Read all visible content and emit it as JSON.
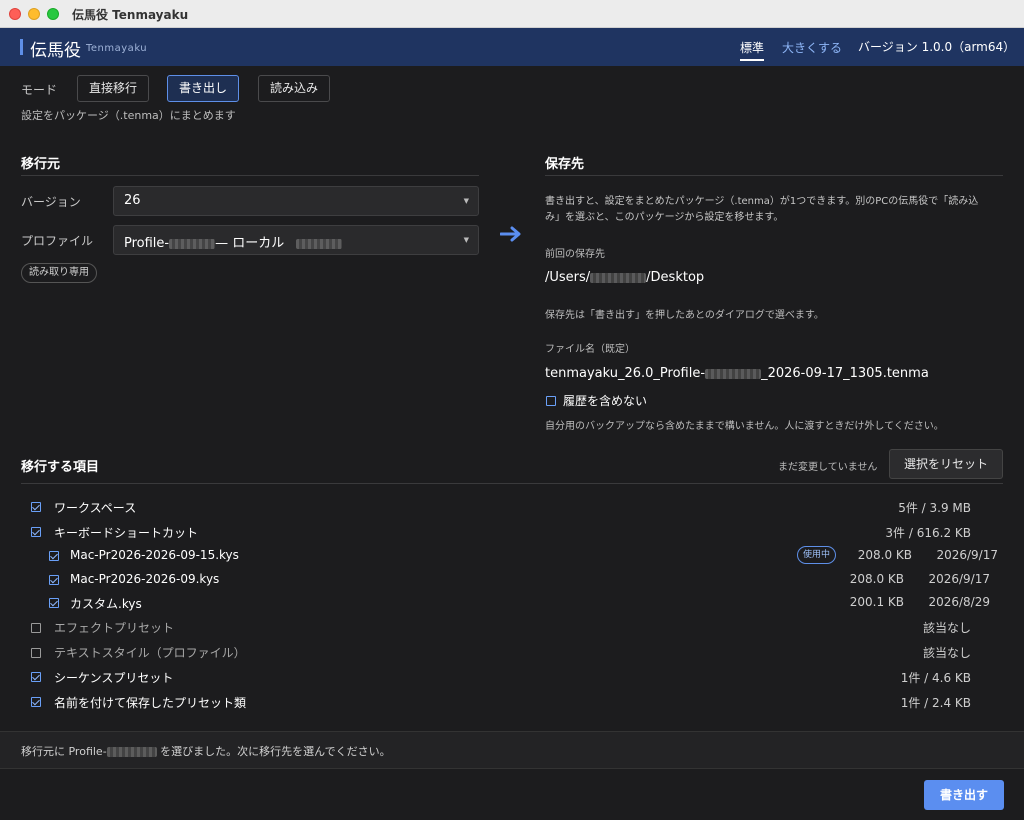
{
  "window": {
    "title": "伝馬役 Tenmayaku"
  },
  "header": {
    "app_name": "伝馬役",
    "app_sub": "Tenmayaku",
    "size_standard": "標準",
    "size_large": "大きくする",
    "version": "バージョン 1.0.0（arm64）"
  },
  "mode": {
    "label": "モード",
    "options": [
      "直接移行",
      "書き出し",
      "読み込み"
    ],
    "selected": "書き出し",
    "description": "設定をパッケージ（.tenma）にまとめます"
  },
  "source": {
    "title": "移行元",
    "version_label": "バージョン",
    "version_value": "26",
    "profile_label": "プロファイル",
    "profile_prefix": "Profile-",
    "profile_middle": "— ローカル",
    "readonly_pill": "読み取り専用"
  },
  "destination": {
    "title": "保存先",
    "note": "書き出すと、設定をまとめたパッケージ（.tenma）が1つできます。別のPCの伝馬役で「読み込み」を選ぶと、このパッケージから設定を移せます。",
    "note_line1": "書き出すと、設定をまとめたパッケージ（.tenma）が1つできます。別のPCの伝馬役で「読み込",
    "note_line2": "み」を選ぶと、このパッケージから設定を移せます。",
    "last_label": "前回の保存先",
    "last_prefix": "/Users/",
    "last_suffix": "/Desktop",
    "dialog_note": "保存先は「書き出す」を押したあとのダイアログで選べます。",
    "filename_label": "ファイル名（既定）",
    "filename_prefix": "tenmayaku_26.0_Profile-",
    "filename_suffix": "_2026-09-17_1305.tenma",
    "exclude_history_label": "履歴を含めない",
    "exclude_history_checked": false,
    "exclude_history_note": "自分用のバックアップなら含めたままで構いません。人に渡すときだけ外してください。"
  },
  "items": {
    "title": "移行する項目",
    "unchanged": "まだ変更していません",
    "reset_label": "選択をリセット",
    "rows": [
      {
        "label": "ワークスペース",
        "checked": true,
        "info": "5件 / 3.9 MB"
      },
      {
        "label": "キーボードショートカット",
        "checked": true,
        "info": "3件 / 616.2 KB"
      },
      {
        "label": "Mac-Pr2026-2026-09-15.kys",
        "checked": true,
        "badge": "使用中",
        "size": "208.0 KB",
        "date": "2026/9/17"
      },
      {
        "label": "Mac-Pr2026-2026-09.kys",
        "checked": true,
        "size": "208.0 KB",
        "date": "2026/9/17"
      },
      {
        "label": "カスタム.kys",
        "checked": true,
        "size": "200.1 KB",
        "date": "2026/8/29"
      },
      {
        "label": "エフェクトプリセット",
        "checked": false,
        "info": "該当なし"
      },
      {
        "label": "テキストスタイル（プロファイル）",
        "checked": false,
        "info": "該当なし"
      },
      {
        "label": "シーケンスプリセット",
        "checked": true,
        "info": "1件 / 4.6 KB"
      },
      {
        "label": "名前を付けて保存したプリセット類",
        "checked": true,
        "info": "1件 / 2.4 KB"
      }
    ]
  },
  "status": {
    "prefix": "移行元に Profile-",
    "suffix": " を選びました。次に移行先を選んでください。"
  },
  "footer": {
    "export_label": "書き出す"
  },
  "colors": {
    "accent": "#5b8ef0",
    "header_bg": "#1f3461",
    "body_bg": "#1c1c1e"
  }
}
